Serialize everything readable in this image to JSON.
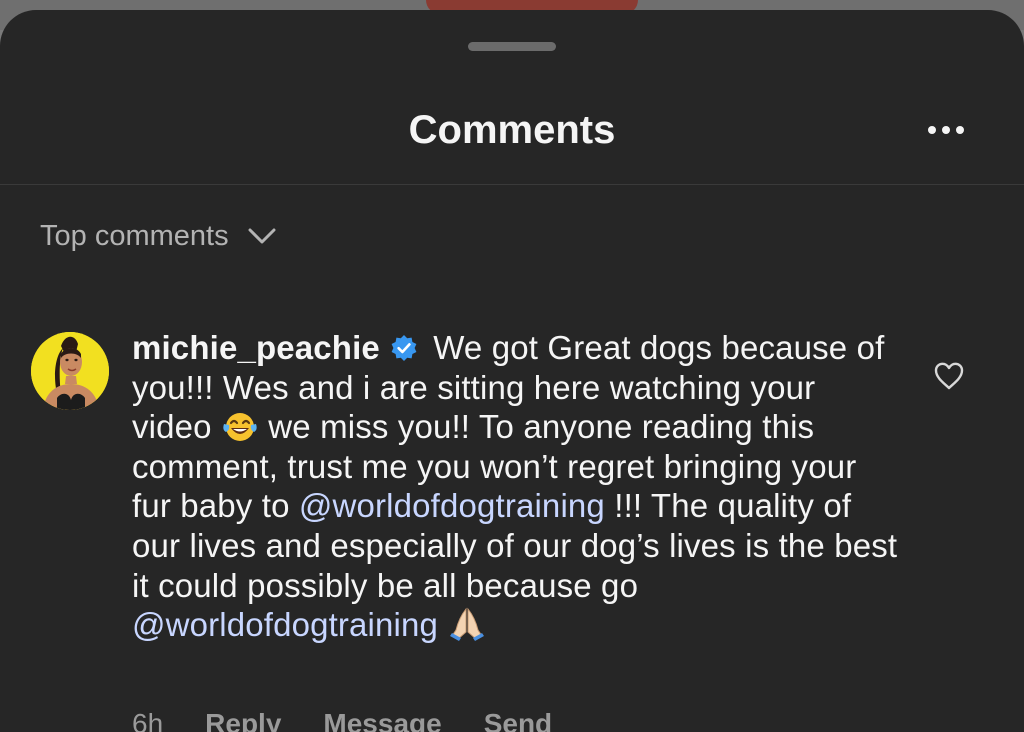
{
  "sheet": {
    "title": "Comments",
    "more_icon": "more-horizontal-icon"
  },
  "sort": {
    "label": "Top comments",
    "icon": "chevron-down-icon"
  },
  "comment": {
    "avatar_icon": "profile-photo",
    "username": "michie_peachie",
    "verified_icon": "verified-badge-icon",
    "segments": [
      " We got Great dogs because of you!!! Wes and i are sitting here watching your video ",
      " we miss you!! To anyone reading this comment, trust me you won’t regret bringing your fur baby to ",
      " !!! The quality of our lives and especially of our dog’s lives is the best it could possibly be all because go "
    ],
    "emoji_1": "face-with-tears-of-joy-emoji",
    "emoji_2": "folded-hands-emoji",
    "mention_1": "@worldofdogtraining",
    "mention_2": "@worldofdogtraining",
    "like_icon": "heart-outline-icon",
    "timestamp": "6h",
    "actions": {
      "reply": "Reply",
      "message": "Message",
      "send": "Send"
    }
  },
  "colors": {
    "sheet_background": "#262626",
    "text_primary": "#f5f5f5",
    "text_secondary": "#9a9a9a",
    "mention": "#c8d6ff",
    "verified": "#3897f0",
    "avatar_background": "#f2e020"
  }
}
